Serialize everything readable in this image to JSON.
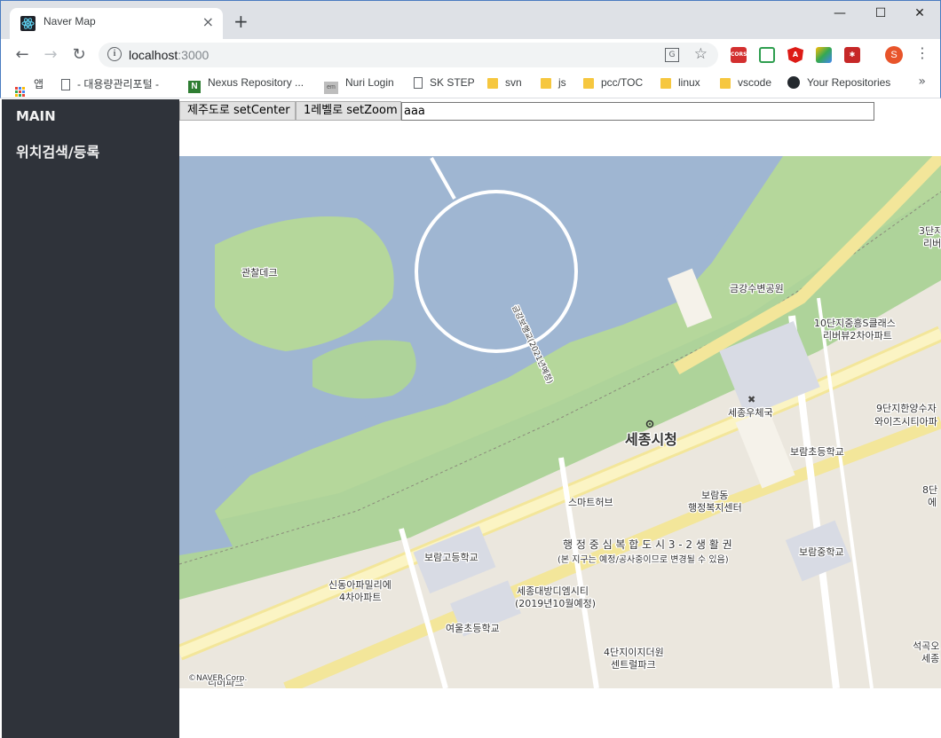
{
  "browser": {
    "tab_title": "Naver Map",
    "tab_close": "×",
    "new_tab": "+",
    "url_host": "localhost",
    "url_port": ":3000",
    "window_controls": {
      "minimize": "—",
      "maximize": "☐",
      "close": "✕"
    },
    "profile_initial": "S",
    "extensions": [
      "CORS",
      "ext-green",
      "Angular",
      "ext-multicolor",
      "ext-red-bug"
    ]
  },
  "bookmarks": [
    {
      "label": "앱",
      "icon": "apps-grid-icon"
    },
    {
      "label": "- 대용량관리포털 -",
      "icon": "page-icon"
    },
    {
      "label": "Nexus Repository ...",
      "icon": "nexus-icon"
    },
    {
      "label": "Nuri Login",
      "icon": "em-icon"
    },
    {
      "label": "SK STEP",
      "icon": "page-icon"
    },
    {
      "label": "svn",
      "icon": "folder-icon"
    },
    {
      "label": "js",
      "icon": "folder-icon"
    },
    {
      "label": "pcc/TOC",
      "icon": "folder-icon"
    },
    {
      "label": "linux",
      "icon": "folder-icon"
    },
    {
      "label": "vscode",
      "icon": "folder-icon"
    },
    {
      "label": "Your Repositories",
      "icon": "github-icon"
    }
  ],
  "sidebar": {
    "title": "MAIN",
    "items": [
      {
        "label": "위치검색/등록"
      }
    ]
  },
  "controls": {
    "set_center_label": "제주도로 setCenter",
    "set_zoom_label": "1레벨로 setZoom",
    "input_value": "aaa"
  },
  "map": {
    "labels": {
      "observation_deck": "관찰데크",
      "riverside_park": "금강수변공원",
      "bridge_note": "금강보행교(2021년예정)",
      "apt_10": "10단지중흥S클래스",
      "apt_10b": "리버뷰2차아파트",
      "apt_3": "3단지",
      "apt_3b": "리버",
      "apt_9": "9단지한양수자",
      "apt_9b": "와이즈시티아파",
      "post_office": "세종우체국",
      "city_hall": "세종시청",
      "boram_elem": "보람초등학교",
      "smart_hub": "스마트허브",
      "boram_welfare": "보람동",
      "boram_welfare_b": "행정복지센터",
      "apt_8": "8단",
      "apt_8b": "에",
      "admin_zone": "행 정 중 심 복 합 도 시 3 - 2 생 활 권",
      "admin_zone_note": "(본 지구는 예정/공사중이므로 변경될 수 있음)",
      "boram_high": "보람고등학교",
      "boram_middle": "보람중학교",
      "apt_shindong": "신동아파밀리에",
      "apt_shindong_b": "4차아파트",
      "apt_daebang": "세종대방디엠시티",
      "apt_daebang_b": "(2019년10월예정)",
      "yeoul_elem": "여울초등학교",
      "apt_4": "4단지이지더원",
      "apt_4b": "센트럴파크",
      "apt_seokgok": "석곡오",
      "apt_seokgok_b": "세종",
      "apt_bl": "리버파크",
      "copyright": "©NAVER Corp."
    }
  }
}
